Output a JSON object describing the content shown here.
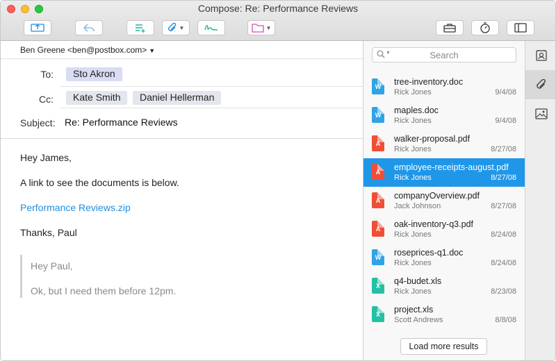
{
  "window": {
    "title": "Compose: Re: Performance Reviews"
  },
  "compose": {
    "from": "Ben Greene <ben@postbox.com>",
    "to_label": "To:",
    "to": [
      "Sto Akron"
    ],
    "cc_label": "Cc:",
    "cc": [
      "Kate Smith",
      "Daniel Hellerman"
    ],
    "subject_label": "Subject:",
    "subject": "Re: Performance Reviews",
    "body": {
      "greeting": "Hey James,",
      "line1": "A link to see the documents is below.",
      "link": "Performance Reviews.zip",
      "signoff": "Thanks, Paul"
    },
    "quote": {
      "line1": "Hey Paul,",
      "line2": "Ok, but I need them before 12pm."
    }
  },
  "attachments": {
    "search_placeholder": "Search",
    "files": [
      {
        "name": "tree-inventory.doc",
        "author": "Rick Jones",
        "date": "9/4/08",
        "type": "doc",
        "glyph": "W",
        "selected": false
      },
      {
        "name": "maples.doc",
        "author": "Rick Jones",
        "date": "9/4/08",
        "type": "doc",
        "glyph": "W",
        "selected": false
      },
      {
        "name": "walker-proposal.pdf",
        "author": "Rick Jones",
        "date": "8/27/08",
        "type": "pdf",
        "glyph": "A",
        "selected": false
      },
      {
        "name": "employee-receipts-august.pdf",
        "author": "Rick Jones",
        "date": "8/27/08",
        "type": "pdf",
        "glyph": "A",
        "selected": true
      },
      {
        "name": "companyOverview.pdf",
        "author": "Jack Johnson",
        "date": "8/27/08",
        "type": "pdf",
        "glyph": "A",
        "selected": false
      },
      {
        "name": "oak-inventory-q3.pdf",
        "author": "Rick Jones",
        "date": "8/24/08",
        "type": "pdf",
        "glyph": "A",
        "selected": false
      },
      {
        "name": "roseprices-q1.doc",
        "author": "Rick Jones",
        "date": "8/24/08",
        "type": "doc",
        "glyph": "W",
        "selected": false
      },
      {
        "name": "q4-budet.xls",
        "author": "Rick Jones",
        "date": "8/23/08",
        "type": "xls",
        "glyph": "X",
        "selected": false
      },
      {
        "name": "project.xls",
        "author": "Scott Andrews",
        "date": "8/8/08",
        "type": "xls",
        "glyph": "X",
        "selected": false
      }
    ],
    "load_more_label": "Load more results"
  },
  "toolbar": {
    "icons": [
      "send-icon",
      "reply-icon",
      "format-list-icon",
      "attach-icon",
      "signature-icon",
      "folder-icon",
      "briefcase-icon",
      "timer-icon",
      "sidebar-toggle-icon"
    ]
  },
  "sidebar": {
    "icons": [
      "contacts-icon",
      "attachments-icon",
      "images-icon"
    ],
    "active": "attachments-icon"
  },
  "colors": {
    "accent": "#1f96e8",
    "link": "#1f8fde",
    "doc": "#2fa3e6",
    "pdf": "#f04e36",
    "xls": "#23c1a3",
    "to_chip": "#d9dcf3",
    "cc_chip": "#e3e6ec"
  }
}
